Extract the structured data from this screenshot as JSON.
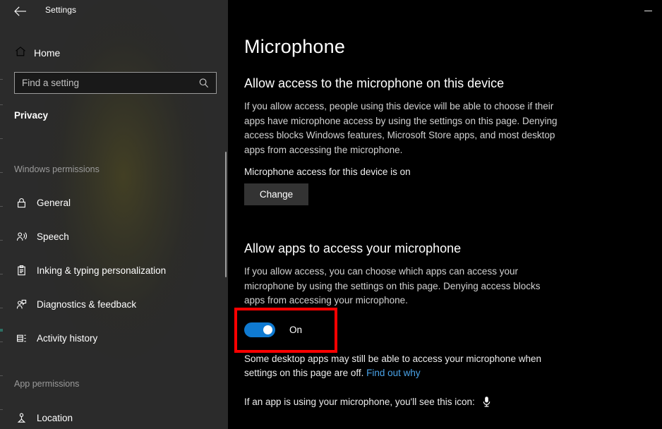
{
  "window": {
    "title": "Settings",
    "back_icon": "back-arrow-icon",
    "minimize_label": "Minimize"
  },
  "sidebar": {
    "home": {
      "label": "Home",
      "icon": "home-icon"
    },
    "search": {
      "placeholder": "Find a setting",
      "value": "",
      "icon": "search-icon"
    },
    "section_title": "Privacy",
    "groups": [
      {
        "label": "Windows permissions",
        "items": [
          {
            "label": "General",
            "icon": "lock-icon"
          },
          {
            "label": "Speech",
            "icon": "person-speaking-icon"
          },
          {
            "label": "Inking & typing personalization",
            "icon": "clipboard-icon"
          },
          {
            "label": "Diagnostics & feedback",
            "icon": "person-feedback-icon"
          },
          {
            "label": "Activity history",
            "icon": "timeline-icon"
          }
        ]
      },
      {
        "label": "App permissions",
        "items": [
          {
            "label": "Location",
            "icon": "location-pin-icon"
          }
        ]
      }
    ]
  },
  "main": {
    "page_title": "Microphone",
    "device_section": {
      "heading": "Allow access to the microphone on this device",
      "description": "If you allow access, people using this device will be able to choose if their apps have microphone access by using the settings on this page. Denying access blocks Windows features, Microsoft Store apps, and most desktop apps from accessing the microphone.",
      "status": "Microphone access for this device is on",
      "change_button": "Change"
    },
    "apps_section": {
      "heading": "Allow apps to access your microphone",
      "description": "If you allow access, you can choose which apps can access your microphone by using the settings on this page. Denying access blocks apps from accessing your microphone.",
      "toggle_state": "On",
      "toggle_color": "#0f7ad1"
    },
    "notes": {
      "desktop_apps_text": "Some desktop apps may still be able to access your microphone when settings on this page are off. ",
      "find_out_why_link": "Find out why",
      "icon_note_text": "If an app is using your microphone, you'll see this icon:",
      "icon_note_glyph": "microphone-icon"
    }
  },
  "annotation": {
    "highlight_color": "#fe0000",
    "target": "allow-apps-microphone-toggle"
  }
}
